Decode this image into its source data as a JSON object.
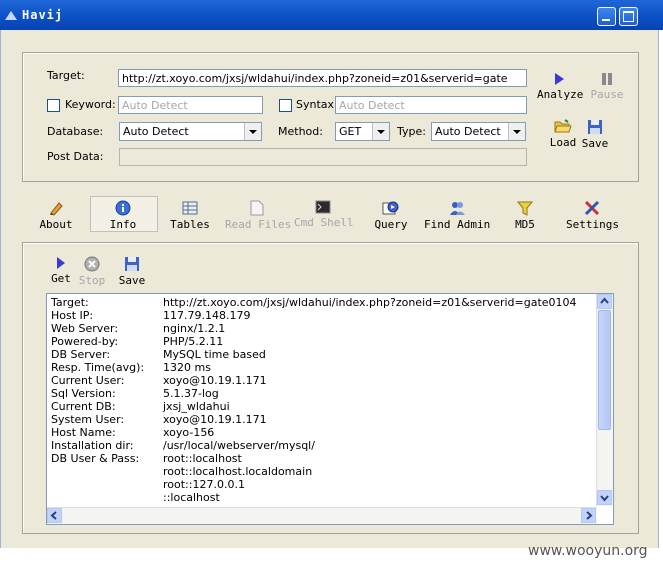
{
  "window": {
    "title": "Havij"
  },
  "form": {
    "target_label": "Target:",
    "target_value": "http://zt.xoyo.com/jxsj/wldahui/index.php?zoneid=z01&serverid=gate",
    "keyword_label": "Keyword:",
    "keyword_placeholder": "Auto Detect",
    "syntax_label": "Syntax:",
    "syntax_placeholder": "Auto Detect",
    "database_label": "Database:",
    "database_value": "Auto Detect",
    "method_label": "Method:",
    "method_value": "GET",
    "type_label": "Type:",
    "type_value": "Auto Detect",
    "postdata_label": "Post Data:"
  },
  "actions": {
    "analyze": "Analyze",
    "pause": "Pause",
    "load": "Load",
    "save": "Save"
  },
  "toolbar": [
    {
      "label": "About",
      "icon": "pen-icon"
    },
    {
      "label": "Info",
      "icon": "info-icon",
      "active": true
    },
    {
      "label": "Tables",
      "icon": "table-icon"
    },
    {
      "label": "Read Files",
      "icon": "file-icon",
      "disabled": true
    },
    {
      "label": "Cmd Shell",
      "icon": "console-icon",
      "disabled": true
    },
    {
      "label": "Query",
      "icon": "query-icon"
    },
    {
      "label": "Find Admin",
      "icon": "users-icon"
    },
    {
      "label": "MD5",
      "icon": "funnel-icon"
    },
    {
      "label": "Settings",
      "icon": "tools-icon"
    }
  ],
  "info_toolbar": {
    "get": "Get",
    "stop": "Stop",
    "save": "Save"
  },
  "info": [
    {
      "key": "Target:",
      "value": "http://zt.xoyo.com/jxsj/wldahui/index.php?zoneid=z01&serverid=gate0104"
    },
    {
      "key": "Host IP:",
      "value": "117.79.148.179"
    },
    {
      "key": "Web Server:",
      "value": "nginx/1.2.1"
    },
    {
      "key": "Powered-by:",
      "value": "PHP/5.2.11"
    },
    {
      "key": "DB Server:",
      "value": "MySQL time based"
    },
    {
      "key": "Resp. Time(avg):",
      "value": "1320 ms"
    },
    {
      "key": "Current User:",
      "value": "xoyo@10.19.1.171"
    },
    {
      "key": "Sql Version:",
      "value": "5.1.37-log"
    },
    {
      "key": "Current DB:",
      "value": "jxsj_wldahui"
    },
    {
      "key": "System User:",
      "value": "xoyo@10.19.1.171"
    },
    {
      "key": "Host Name:",
      "value": "xoyo-156"
    },
    {
      "key": "Installation dir:",
      "value": "/usr/local/webserver/mysql/"
    },
    {
      "key": "DB User & Pass:",
      "value": "root::localhost"
    },
    {
      "key": "",
      "value": "root::localhost.localdomain"
    },
    {
      "key": "",
      "value": "root::127.0.0.1"
    },
    {
      "key": "",
      "value": "::localhost"
    }
  ],
  "watermark": "www.wooyun.org"
}
